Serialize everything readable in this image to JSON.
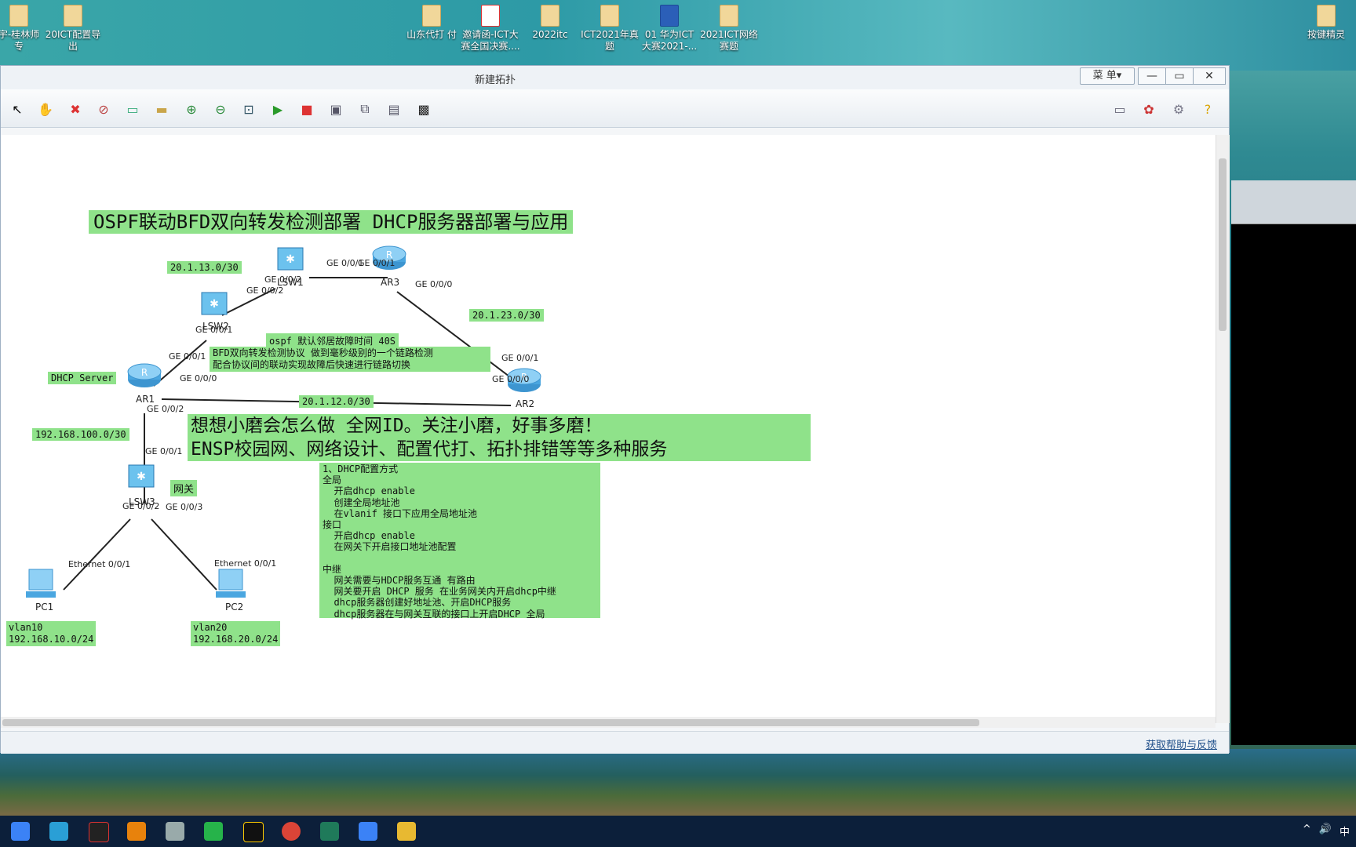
{
  "desktop_icons": [
    {
      "label": "宇-桂林师\n专",
      "type": "folder"
    },
    {
      "label": "20ICT配置导\n出",
      "type": "folder"
    },
    {
      "label": "山东代打 付",
      "type": "folder"
    },
    {
      "label": "邀请函-ICT大\n赛全国决赛....",
      "type": "pdf"
    },
    {
      "label": "2022itc",
      "type": "folder"
    },
    {
      "label": "ICT2021年真\n题",
      "type": "folder"
    },
    {
      "label": "01 华为ICT\n大赛2021-...",
      "type": "word"
    },
    {
      "label": "2021ICT网络\n赛题",
      "type": "folder"
    },
    {
      "label": "按键精灵",
      "type": "folder"
    }
  ],
  "window": {
    "title": "新建拓扑",
    "menu_label": "菜 单▾",
    "minimize": "—",
    "maximize": "▭",
    "close": "✕",
    "help_link": "获取帮助与反馈"
  },
  "toolbar_icons": [
    "pointer-icon",
    "hand-icon",
    "delete-icon",
    "clear-icon",
    "text-icon",
    "rectangle-icon",
    "zoom-in-icon",
    "zoom-out-icon",
    "fit-icon",
    "start-icon",
    "stop-icon",
    "capture-icon",
    "topology-icon",
    "grid-icon",
    "screenshot-icon"
  ],
  "toolbar_right_icons": [
    "chat-icon",
    "huawei-icon",
    "settings-icon",
    "help-icon"
  ],
  "diagram": {
    "title": "OSPF联动BFD双向转发检测部署 DHCP服务器部署与应用",
    "net_13": "20.1.13.0/30",
    "net_23": "20.1.23.0/30",
    "net_12": "20.1.12.0/30",
    "net_100": "192.168.100.0/30",
    "dhcp_server": "DHCP Server",
    "gateway": "网关",
    "ospf_note": "ospf 默认邻居故障时间 40S",
    "bfd_note": "BFD双向转发检测协议 做到毫秒级别的一个链路检测\n配合协议间的联动实现故障后快速进行链路切换",
    "promo": "想想小磨会怎么做 全网ID。关注小磨，好事多磨！\nENSP校园网、网络设计、配置代打、拓扑排错等等多种服务",
    "dhcp_notes": "1、DHCP配置方式\n全局\n  开启dhcp enable\n  创建全局地址池\n  在vlanif 接口下应用全局地址池\n接口\n  开启dhcp enable\n  在网关下开启接口地址池配置\n\n中继\n  网关需要与HDCP服务互通 有路由\n  网关要开启 DHCP 服务 在业务网关内开启dhcp中继\n  dhcp服务器创建好地址池、开启DHCP服务\n  dhcp服务器在与网关互联的接口上开启DHCP 全局",
    "vlan10": "vlan10\n192.168.10.0/24",
    "vlan20": "vlan20\n192.168.20.0/24",
    "devices": {
      "lsw1": "LSW1",
      "lsw2": "LSW2",
      "lsw3": "LSW3",
      "ar1": "AR1",
      "ar2": "AR2",
      "ar3": "AR3",
      "pc1": "PC1",
      "pc2": "PC2"
    },
    "ports": {
      "lsw1_ar3": "GE 0/0/1",
      "ar3_lsw1": "GE 0/0/1",
      "lsw1_lsw2": "GE 0/0/2",
      "lsw2_lsw1": "GE 0/0/2",
      "ar3_ar2": "GE 0/0/0",
      "ar2_ar3": "GE 0/0/1",
      "lsw2_ar1": "GE 0/0/1",
      "ar1_lsw2": "GE 0/0/1",
      "ar1_ar2": "GE 0/0/0",
      "ar2_ar1": "GE 0/0/0",
      "ar1_lsw3": "GE 0/0/2",
      "lsw3_ar1": "GE 0/0/1",
      "lsw3_pc1": "GE 0/0/2",
      "lsw3_pc2": "GE 0/0/3",
      "pc1_eth": "Ethernet 0/0/1",
      "pc2_eth": "Ethernet 0/0/1"
    }
  },
  "tray": {
    "ime": "中",
    "volume": "🔊"
  },
  "colors": {
    "label_bg": "#8fe28a",
    "router": "#4aa6e0",
    "switch": "#6cc2ee",
    "taskbar": "#0c1f3a"
  }
}
